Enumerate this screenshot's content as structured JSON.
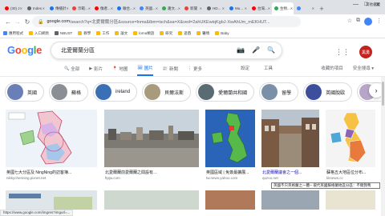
{
  "browser": {
    "tabs": [
      {
        "label": "(30) J",
        "color": "#ff0000"
      },
      {
        "label": "Index",
        "color": "#5f6368"
      },
      {
        "label": "傳播針",
        "color": "#1a73e8"
      },
      {
        "label": "示範...",
        "color": "#ea4335"
      },
      {
        "label": "傷者...",
        "color": "#ff0000"
      },
      {
        "label": "聯合...",
        "color": "#1a73e8"
      },
      {
        "label": "英國...",
        "color": "#4285f4"
      },
      {
        "label": "趣文...",
        "color": "#34a853"
      },
      {
        "label": "新聞",
        "color": "#ea4335"
      },
      {
        "label": "HD...",
        "color": "#5f6368"
      },
      {
        "label": "Mu...",
        "color": "#1a73e8"
      },
      {
        "label": "台灣...",
        "color": "#ff0000"
      },
      {
        "label": "生物...",
        "color": "#34a853"
      },
      {
        "label": "",
        "color": "#4285f4"
      }
    ],
    "new_tab": "+",
    "window_controls": [
      "—",
      "□",
      "✕"
    ],
    "url_domain": "google.com",
    "url_path": "/search?q=北愛爾蘭分區&source=lnms&tbm=isch&sa=X&ved=2ahUKEwiqKgbJ-XwAhUm_mEKHUT...",
    "bookmarks": [
      {
        "label": "應用程式",
        "color": "#4285f4"
      },
      {
        "label": "入口網頁",
        "color": "#fbbc05"
      },
      {
        "label": "NBUST",
        "color": "#5f6368"
      },
      {
        "label": "教學",
        "color": "#fbbc05"
      },
      {
        "label": "工作",
        "color": "#fbbc05"
      },
      {
        "label": "論文",
        "color": "#fbbc05"
      },
      {
        "label": "lorna類遊",
        "color": "#fbbc05"
      },
      {
        "label": "研究",
        "color": "#fbbc05"
      },
      {
        "label": "遊戲",
        "color": "#fbbc05"
      },
      {
        "label": "醫情",
        "color": "#fbbc05"
      },
      {
        "label": "Baby",
        "color": "#fbbc05"
      }
    ],
    "other_bookmarks": "其他書籤"
  },
  "google": {
    "logo": [
      {
        "ch": "G",
        "color": "#4285f4"
      },
      {
        "ch": "o",
        "color": "#ea4335"
      },
      {
        "ch": "o",
        "color": "#fbbc05"
      },
      {
        "ch": "g",
        "color": "#4285f4"
      },
      {
        "ch": "l",
        "color": "#34a853"
      },
      {
        "ch": "e",
        "color": "#ea4335"
      }
    ],
    "query": "北愛爾蘭分區",
    "user_initials": "黑勇",
    "tabs": [
      {
        "icon": "🔍",
        "label": "全部",
        "active": false
      },
      {
        "icon": "▶",
        "label": "影片",
        "active": false
      },
      {
        "icon": "📍",
        "label": "地圖",
        "active": false
      },
      {
        "icon": "🖼",
        "label": "圖片",
        "active": true
      },
      {
        "icon": "📰",
        "label": "新聞",
        "active": false
      },
      {
        "icon": "⋮",
        "label": "更多",
        "active": false
      }
    ],
    "tools": [
      "設定",
      "工具"
    ],
    "right_links": [
      "收藏的項目",
      "安全搜尋 ▾"
    ]
  },
  "chips": [
    {
      "label": "英國",
      "color": "#6a7fb5"
    },
    {
      "label": "蘇格",
      "color": "#8a8f95"
    },
    {
      "label": "ireland",
      "color": "#3b6fb6"
    },
    {
      "label": "貝爾法斯",
      "color": "#a89a7c"
    },
    {
      "label": "愛爾蘭共和國",
      "color": "#5a6b74"
    },
    {
      "label": "留學",
      "color": "#7a8fa8"
    },
    {
      "label": "英國脫歐",
      "color": "#3d4f9c"
    },
    {
      "label": "英格蘭",
      "color": "#b7a6c8"
    }
  ],
  "results": [
    {
      "caption": "英國七大分區及 NingNing的訪客簿...",
      "source": "nikkychenning.pixnet.net"
    },
    {
      "caption": "北愛爾蘭前愛爾蘭之間設有…",
      "source": "ftpjw.com"
    },
    {
      "caption": "英國區域 | 免簽最擴展...",
      "source": "tw.news.yahoo.com"
    },
    {
      "caption": "北愛爾蘭議會之一個...",
      "source": "quzoo.net"
    },
    {
      "caption": "蘇格五大地區位分布...",
      "source": "kknews.cc"
    }
  ],
  "tooltip": "英國不只英格蘭之一體─ 取代英國蘇格蘭地區分區：不間我嗎",
  "status": "https://www.google.com/imgres?imgurl=..."
}
